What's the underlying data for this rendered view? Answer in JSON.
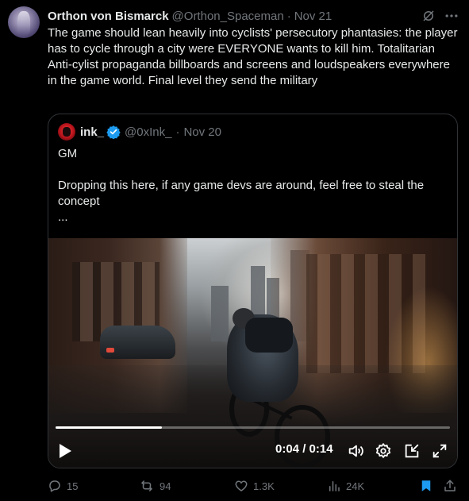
{
  "tweet": {
    "author_name": "Orthon von Bismarck",
    "author_handle": "@Orthon_Spaceman",
    "separator": "·",
    "date": "Nov 21",
    "text": "The game should lean heavily into cyclists' persecutory phantasies: the player has to cycle through a city were EVERYONE wants to kill him. Totalitarian Anti-cylist propaganda billboards and screens and loudspeakers everywhere in the game world. Final level they send the military"
  },
  "quote": {
    "author_name": "ink_",
    "author_handle": "@0xInk_",
    "separator": "·",
    "date": "Nov 20",
    "line1": "GM",
    "line2": "Dropping this here, if any game devs are around, feel free to steal the concept",
    "line3": "...",
    "video": {
      "current_time": "0:04",
      "duration": "0:14",
      "time_display": "0:04 / 0:14",
      "progress": 0.27
    }
  },
  "actions": {
    "replies": "15",
    "reposts": "94",
    "likes": "1.3K",
    "views": "24K"
  },
  "colors": {
    "background": "#000000",
    "text": "#e7e9ea",
    "muted": "#71767b",
    "accent": "#1d9bf0",
    "repost_green": "#00ba7c"
  },
  "icons": [
    "grok-icon",
    "more-icon",
    "verified-icon",
    "play-icon",
    "volume-icon",
    "settings-icon",
    "minimize-icon",
    "fullscreen-icon",
    "reply-icon",
    "repost-icon",
    "like-icon",
    "views-icon",
    "bookmark-icon",
    "share-icon"
  ]
}
